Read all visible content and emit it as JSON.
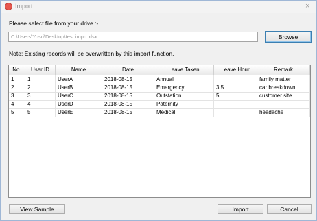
{
  "window": {
    "title": "Import",
    "close_glyph": "×"
  },
  "prompt": "Please select file from your drive :-",
  "file_path": "C:\\Users\\Yusri\\Desktop\\test imprt.xlsx",
  "buttons": {
    "browse": "Browse",
    "view_sample": "View Sample",
    "import": "Import",
    "cancel": "Cancel"
  },
  "note": "Note: Existing records will be overwritten by this import function.",
  "table": {
    "columns": [
      "No.",
      "User ID",
      "Name",
      "Date",
      "Leave Taken",
      "Leave Hour",
      "Remark"
    ],
    "rows": [
      [
        "1",
        "1",
        "UserA",
        "2018-08-15",
        "Annual",
        "",
        "family matter"
      ],
      [
        "2",
        "2",
        "UserB",
        "2018-08-15",
        "Emergency",
        "3.5",
        "car breakdown"
      ],
      [
        "3",
        "3",
        "UserC",
        "2018-08-15",
        "Outstation",
        "5",
        "customer site"
      ],
      [
        "4",
        "4",
        "UserD",
        "2018-08-15",
        "Paternity",
        "",
        ""
      ],
      [
        "5",
        "5",
        "UserE",
        "2018-08-15",
        "Medical",
        "",
        "headache"
      ]
    ]
  }
}
